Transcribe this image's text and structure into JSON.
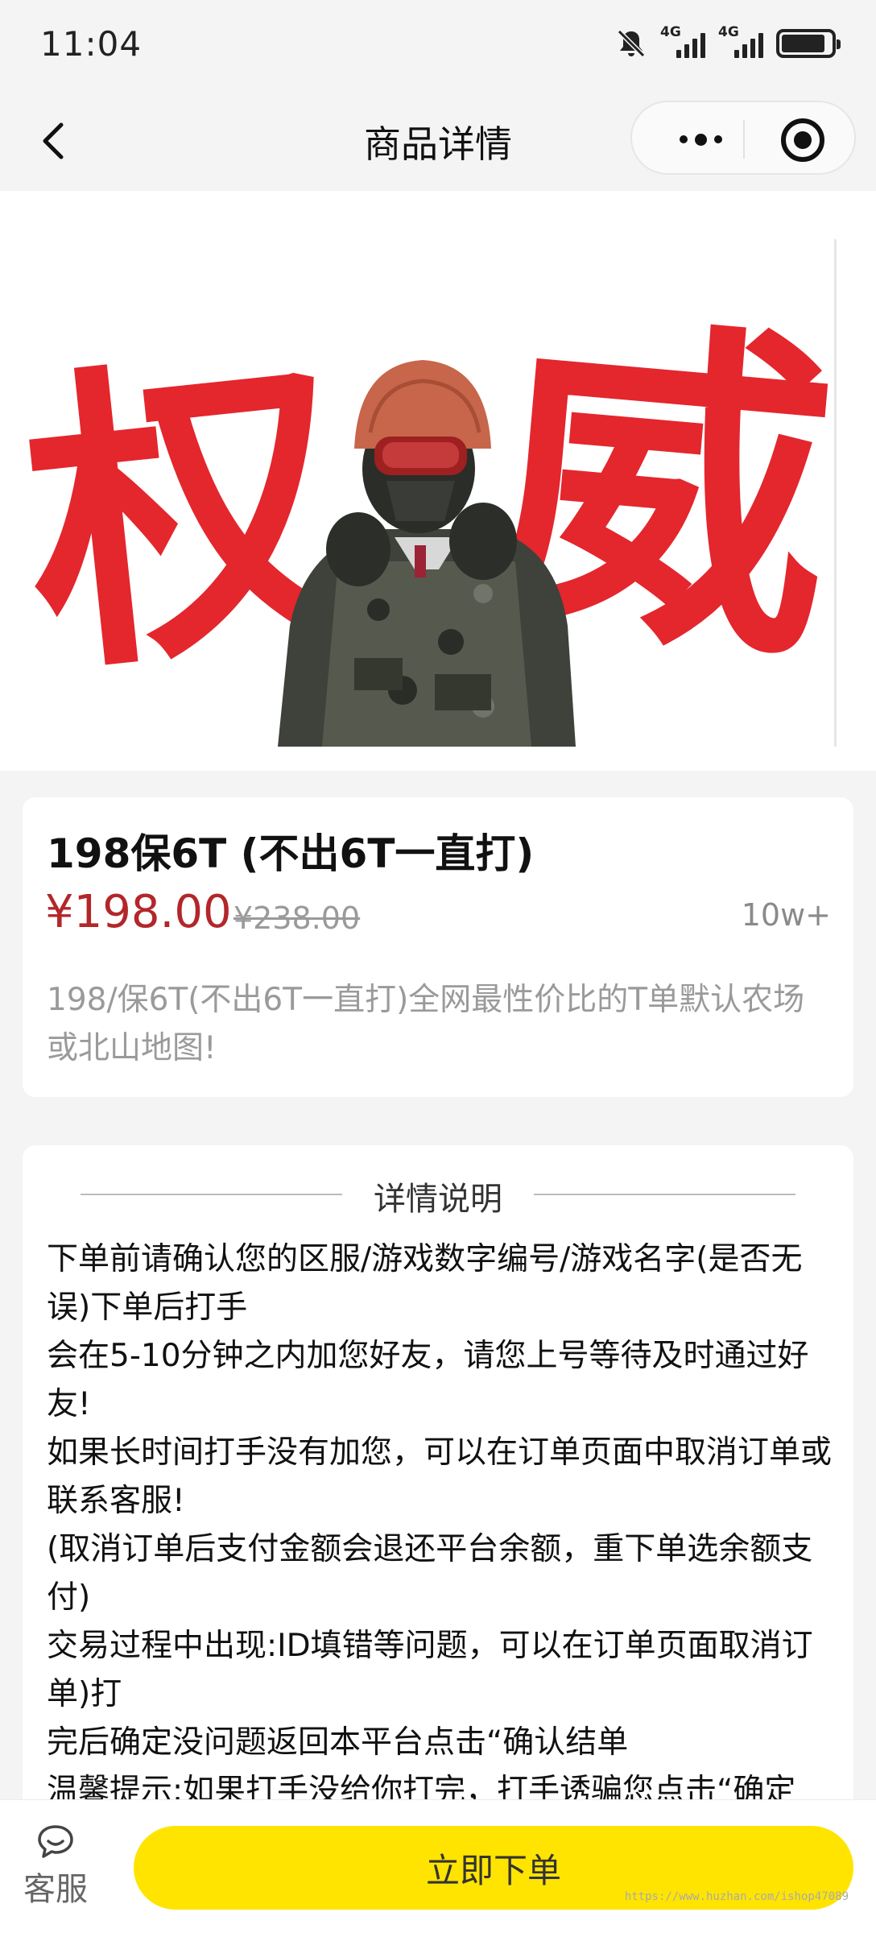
{
  "status_bar": {
    "time": "11:04",
    "network_1": "4G",
    "network_2": "4G"
  },
  "nav": {
    "title": "商品详情"
  },
  "hero": {
    "calligraphy_left": "权",
    "calligraphy_right": "威",
    "calligraphy_color": "#e2141c"
  },
  "product": {
    "title": "198保6T (不出6T一直打)",
    "price": "¥198.00",
    "original_price": "¥238.00",
    "sales": "10w+",
    "subtitle": "198/保6T(不出6T一直打)全网最性价比的T单默认农场或北山地图!"
  },
  "detail": {
    "heading": "详情说明",
    "lines": [
      "下单前请确认您的区服/游戏数字编号/游戏名字(是否无误)下单后打手",
      "会在5-10分钟之内加您好友，请您上号等待及时通过好友!",
      "如果长时间打手没有加您，可以在订单页面中取消订单或联系客服!",
      "(取消订单后支付金额会退还平台余额，重下单选余额支付)",
      "交易过程中出现:ID填错等问题，可以在订单页面取消订单)打",
      "完后确定没问题返回本平台点击“确认结单",
      "温馨提示:如果打手没给你打完，打手诱骗您点击“确定"
    ]
  },
  "bottom_bar": {
    "service_label": "客服",
    "order_button": "立即下单",
    "watermark": "https://www.huzhan.com/ishop47089"
  },
  "colors": {
    "accent_price": "#b3262a",
    "order_button_bg": "#ffe400"
  }
}
